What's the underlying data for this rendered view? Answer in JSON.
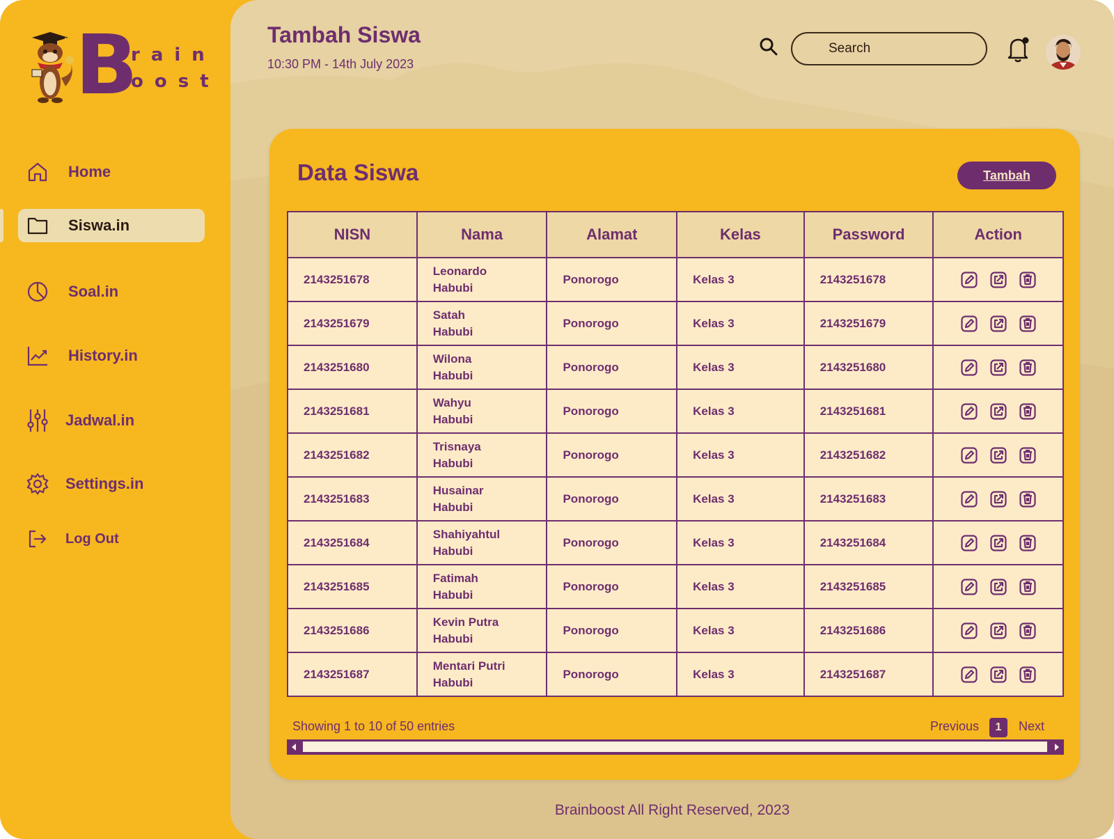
{
  "brand": {
    "letter": "B",
    "row1": "rain",
    "row2": "oost"
  },
  "sidebar": {
    "items": [
      {
        "label": "Home",
        "icon": "home-icon"
      },
      {
        "label": "Siswa.in",
        "icon": "folder-icon",
        "active": true
      },
      {
        "label": "Soal.in",
        "icon": "pie-chart-icon"
      },
      {
        "label": "History.in",
        "icon": "trend-chart-icon"
      },
      {
        "label": "Jadwal.in",
        "icon": "sliders-icon"
      },
      {
        "label": "Settings.in",
        "icon": "gear-icon"
      },
      {
        "label": "Log Out",
        "icon": "logout-icon"
      }
    ]
  },
  "header": {
    "title": "Tambah Siswa",
    "datetime": "10:30 PM - 14th July 2023",
    "search_placeholder": "Search"
  },
  "card": {
    "title": "Data Siswa",
    "add_label": "Tambah",
    "columns": [
      "NISN",
      "Nama",
      "Alamat",
      "Kelas",
      "Password",
      "Action"
    ],
    "rows": [
      {
        "nisn": "2143251678",
        "nama1": "Leonardo",
        "nama2": "Habubi",
        "alamat": "Ponorogo",
        "kelas": "Kelas 3",
        "password": "2143251678"
      },
      {
        "nisn": "2143251679",
        "nama1": "Satah",
        "nama2": "Habubi",
        "alamat": "Ponorogo",
        "kelas": "Kelas 3",
        "password": "2143251679"
      },
      {
        "nisn": "2143251680",
        "nama1": "Wilona",
        "nama2": "Habubi",
        "alamat": "Ponorogo",
        "kelas": "Kelas 3",
        "password": "2143251680"
      },
      {
        "nisn": "2143251681",
        "nama1": "Wahyu",
        "nama2": "Habubi",
        "alamat": "Ponorogo",
        "kelas": "Kelas 3",
        "password": "2143251681"
      },
      {
        "nisn": "2143251682",
        "nama1": "Trisnaya",
        "nama2": "Habubi",
        "alamat": "Ponorogo",
        "kelas": "Kelas 3",
        "password": "2143251682"
      },
      {
        "nisn": "2143251683",
        "nama1": "Husainar",
        "nama2": "Habubi",
        "alamat": "Ponorogo",
        "kelas": "Kelas 3",
        "password": "2143251683"
      },
      {
        "nisn": "2143251684",
        "nama1": "Shahiyahtul",
        "nama2": "Habubi",
        "alamat": "Ponorogo",
        "kelas": "Kelas 3",
        "password": "2143251684"
      },
      {
        "nisn": "2143251685",
        "nama1": "Fatimah",
        "nama2": "Habubi",
        "alamat": "Ponorogo",
        "kelas": "Kelas 3",
        "password": "2143251685"
      },
      {
        "nisn": "2143251686",
        "nama1": "Kevin Putra",
        "nama2": "Habubi",
        "alamat": "Ponorogo",
        "kelas": "Kelas 3",
        "password": "2143251686"
      },
      {
        "nisn": "2143251687",
        "nama1": "Mentari Putri",
        "nama2": "Habubi",
        "alamat": "Ponorogo",
        "kelas": "Kelas 3",
        "password": "2143251687"
      }
    ],
    "row_actions": [
      "edit-icon",
      "open-external-icon",
      "trash-icon"
    ],
    "entries_text": "Showing 1 to 10 of 50 entries",
    "prev_label": "Previous",
    "current_page": "1",
    "next_label": "Next"
  },
  "footer": {
    "copyright": "Brainboost All Right Reserved, 2023"
  },
  "colors": {
    "primary": "#6E2E6E",
    "accent": "#F7B71F",
    "main_bg": "#E6D2A2",
    "row_bg": "#FDEBC8",
    "header_bg": "#EDD8A6"
  }
}
